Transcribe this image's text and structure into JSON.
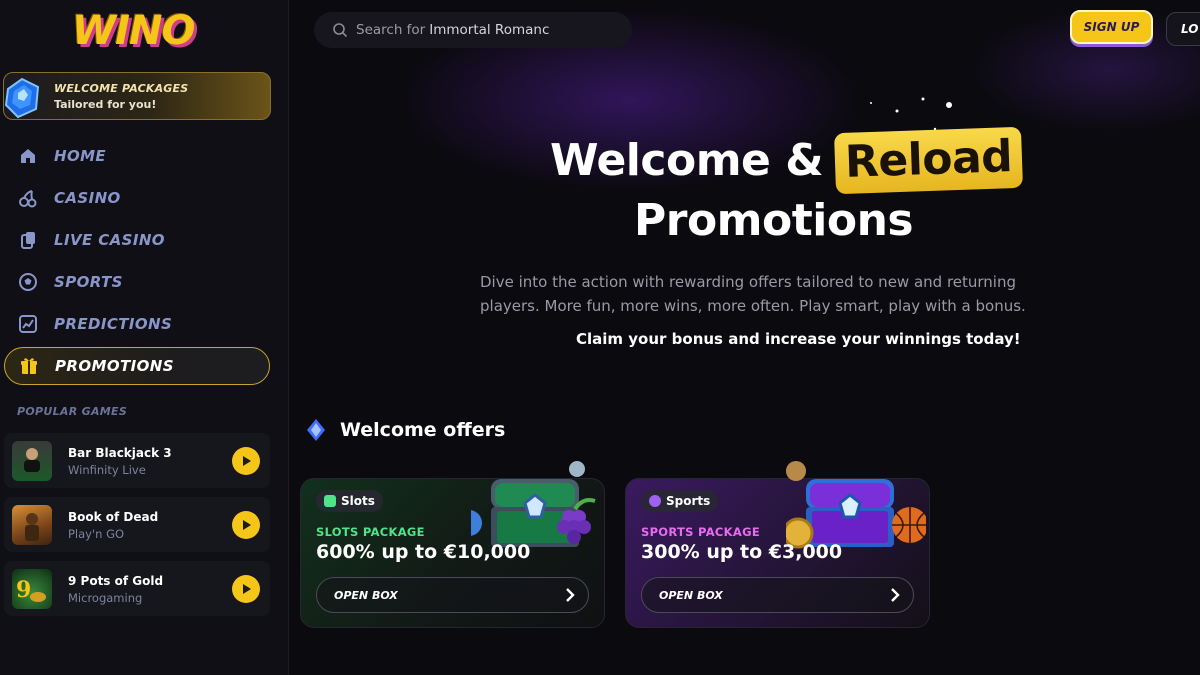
{
  "brand": {
    "logo_text": "WINO"
  },
  "sidebar": {
    "welcome_package": {
      "title": "WELCOME PACKAGES",
      "subtitle": "Tailored for you!"
    },
    "nav": [
      {
        "label": "HOME",
        "icon": "home-icon"
      },
      {
        "label": "CASINO",
        "icon": "cherries-icon"
      },
      {
        "label": "LIVE CASINO",
        "icon": "cards-icon"
      },
      {
        "label": "SPORTS",
        "icon": "soccer-ball-icon"
      },
      {
        "label": "PREDICTIONS",
        "icon": "chart-icon"
      },
      {
        "label": "PROMOTIONS",
        "icon": "gift-icon",
        "active": true
      }
    ],
    "popular_heading": "POPULAR GAMES",
    "games": [
      {
        "name": "Bar Blackjack 3",
        "provider": "Winfinity Live"
      },
      {
        "name": "Book of Dead",
        "provider": "Play'n GO"
      },
      {
        "name": "9 Pots of Gold",
        "provider": "Microgaming"
      }
    ]
  },
  "header": {
    "search": {
      "placeholder": "Search for",
      "value": "Immortal Romanc"
    },
    "signup_label": "SIGN UP",
    "login_label": "LO"
  },
  "hero": {
    "title_part1": "Welcome &",
    "title_highlight": "Reload",
    "title_line2": "Promotions",
    "description": "Dive into the action with rewarding offers tailored to new and returning players. More fun, more wins, more often. Play smart, play with a bonus.",
    "claim": "Claim your bonus and increase your winnings today!"
  },
  "welcome_offers": {
    "title": "Welcome offers",
    "cards": [
      {
        "tag": "Slots",
        "package": "SLOTS PACKAGE",
        "amount": "600% up to €10,000",
        "button": "OPEN BOX"
      },
      {
        "tag": "Sports",
        "package": "SPORTS PACKAGE",
        "amount": "300% up to €3,000",
        "button": "OPEN BOX"
      }
    ]
  },
  "colors": {
    "accent_yellow": "#f5c518",
    "nav_text": "#8a95c9",
    "slots_green": "#4fe38a",
    "sports_pink": "#e76cf2",
    "background": "#0b0a0f"
  }
}
